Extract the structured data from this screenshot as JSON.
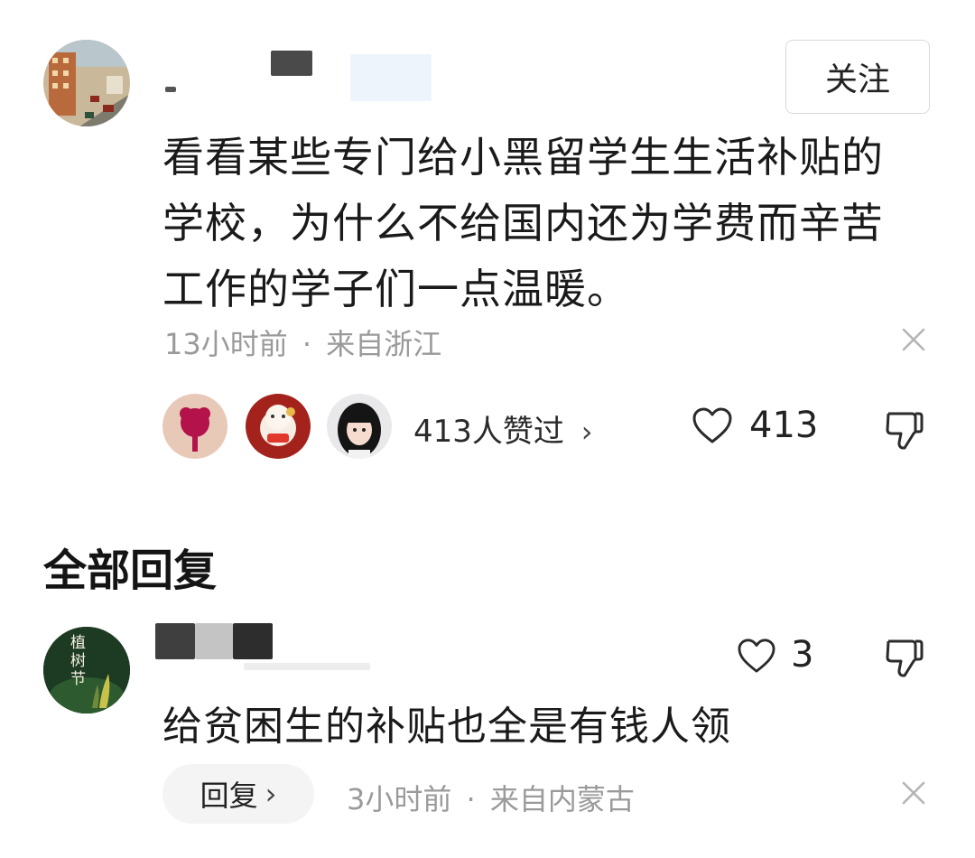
{
  "main_comment": {
    "follow_label": "关注",
    "text": "看看某些专门给小黑留学生生活补贴的学校，为什么不给国内还为学费而辛苦工作的学子们一点温暖。",
    "time": "13小时前",
    "separator": "·",
    "location": "来自浙江",
    "likers_summary": "413人赞过",
    "like_count": "413",
    "icons": {
      "like": "heart-icon",
      "dislike": "thumbs-down-icon",
      "close": "close-icon",
      "more": "chevron-right-icon"
    }
  },
  "section_title": "全部回复",
  "reply": {
    "text": "给贫困生的补贴也全是有钱人领",
    "like_count": "3",
    "reply_label": "回复",
    "time": "3小时前",
    "separator": "·",
    "location": "来自内蒙古",
    "avatar_text": "植树节"
  },
  "colors": {
    "text_primary": "#1a1a1a",
    "text_secondary": "#9a9a9a",
    "button_border": "#d9d9d9",
    "reply_button_bg": "#f4f4f4"
  }
}
